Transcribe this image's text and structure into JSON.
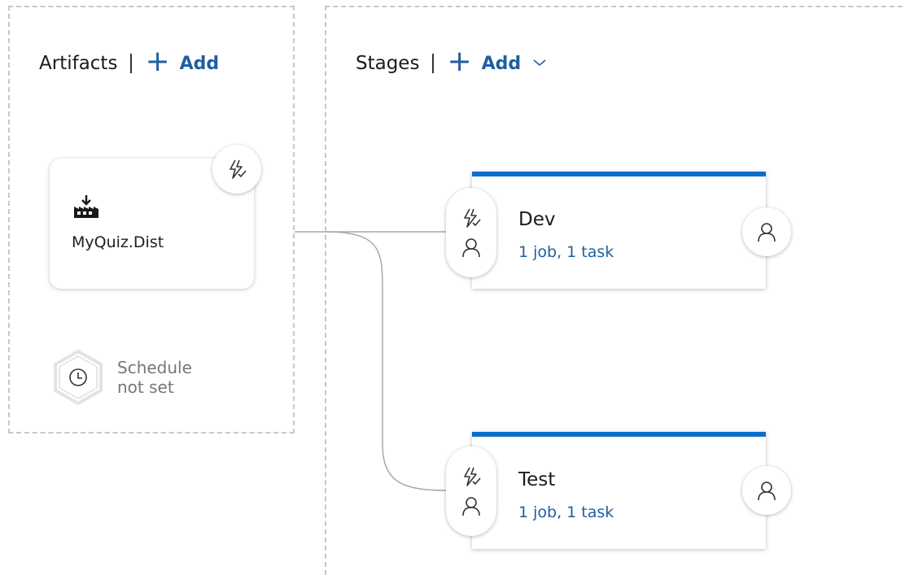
{
  "artifacts": {
    "title": "Artifacts",
    "add_label": "Add",
    "items": [
      {
        "name": "MyQuiz.Dist",
        "icon": "build-artifact-icon"
      }
    ],
    "trigger_icon": "continuous-deployment-trigger-icon",
    "schedule": {
      "line1": "Schedule",
      "line2": "not set",
      "icon": "clock-icon"
    }
  },
  "stages": {
    "title": "Stages",
    "add_label": "Add",
    "items": [
      {
        "name": "Dev",
        "summary": "1 job, 1 task"
      },
      {
        "name": "Test",
        "summary": "1 job, 1 task"
      }
    ]
  },
  "colors": {
    "accent": "#0a6fcc",
    "link": "#1f5fa0",
    "dashed_border": "#c8c8c8",
    "muted_text": "#777777"
  }
}
